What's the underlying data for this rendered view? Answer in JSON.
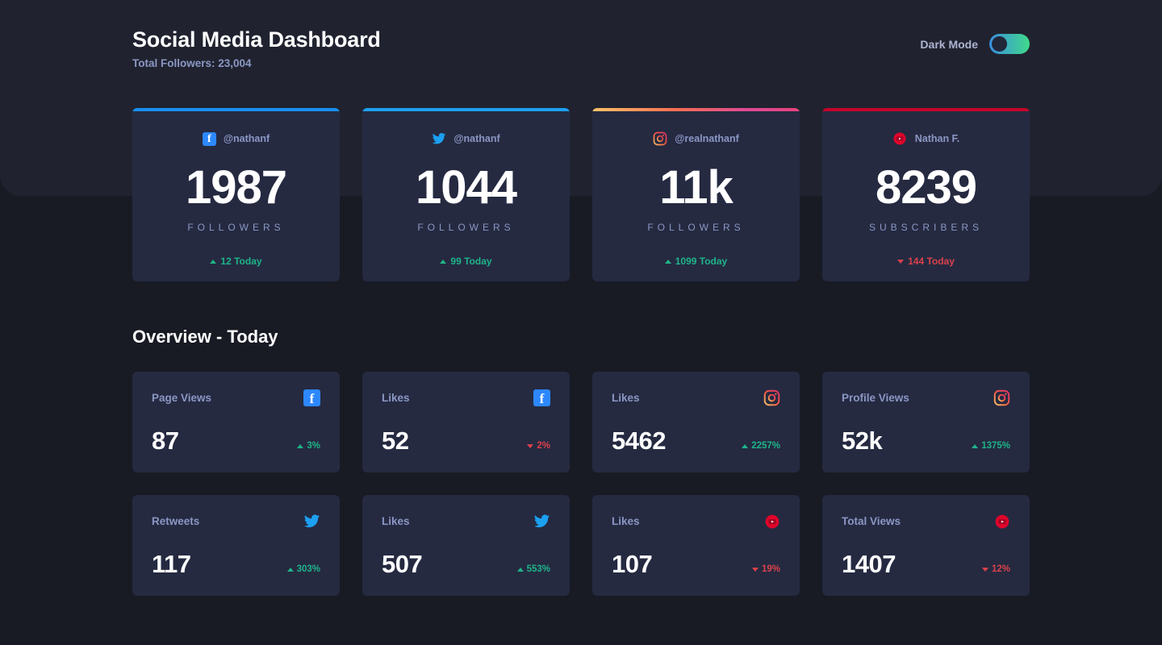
{
  "header": {
    "title": "Social Media Dashboard",
    "subtitle": "Total Followers: 23,004",
    "dark_mode_label": "Dark Mode",
    "dark_mode_on": true
  },
  "colors": {
    "page_bg": "#181b24",
    "band_bg": "#20232f",
    "card_bg": "#252a41",
    "muted_text": "#8b97c4",
    "up": "#1eb589",
    "down": "#dc414c",
    "facebook": "#198ff5",
    "twitter": "#1ca0f2",
    "youtube": "#c4032a"
  },
  "stat_cards": [
    {
      "platform": "facebook",
      "icon": "facebook-icon",
      "handle": "@nathanf",
      "value": "1987",
      "label": "Followers",
      "change": "12 Today",
      "direction": "up"
    },
    {
      "platform": "twitter",
      "icon": "twitter-icon",
      "handle": "@nathanf",
      "value": "1044",
      "label": "Followers",
      "change": "99 Today",
      "direction": "up"
    },
    {
      "platform": "instagram",
      "icon": "instagram-icon",
      "handle": "@realnathanf",
      "value": "11k",
      "label": "Followers",
      "change": "1099 Today",
      "direction": "up"
    },
    {
      "platform": "youtube",
      "icon": "youtube-icon",
      "handle": "Nathan F.",
      "value": "8239",
      "label": "Subscribers",
      "change": "144 Today",
      "direction": "down"
    }
  ],
  "overview": {
    "title": "Overview - Today",
    "cards": [
      {
        "label": "Page Views",
        "platform": "facebook",
        "icon": "facebook-icon",
        "value": "87",
        "change": "3%",
        "direction": "up"
      },
      {
        "label": "Likes",
        "platform": "facebook",
        "icon": "facebook-icon",
        "value": "52",
        "change": "2%",
        "direction": "down"
      },
      {
        "label": "Likes",
        "platform": "instagram",
        "icon": "instagram-icon",
        "value": "5462",
        "change": "2257%",
        "direction": "up"
      },
      {
        "label": "Profile Views",
        "platform": "instagram",
        "icon": "instagram-icon",
        "value": "52k",
        "change": "1375%",
        "direction": "up"
      },
      {
        "label": "Retweets",
        "platform": "twitter",
        "icon": "twitter-icon",
        "value": "117",
        "change": "303%",
        "direction": "up"
      },
      {
        "label": "Likes",
        "platform": "twitter",
        "icon": "twitter-icon",
        "value": "507",
        "change": "553%",
        "direction": "up"
      },
      {
        "label": "Likes",
        "platform": "youtube",
        "icon": "youtube-icon",
        "value": "107",
        "change": "19%",
        "direction": "down"
      },
      {
        "label": "Total Views",
        "platform": "youtube",
        "icon": "youtube-icon",
        "value": "1407",
        "change": "12%",
        "direction": "down"
      }
    ]
  }
}
